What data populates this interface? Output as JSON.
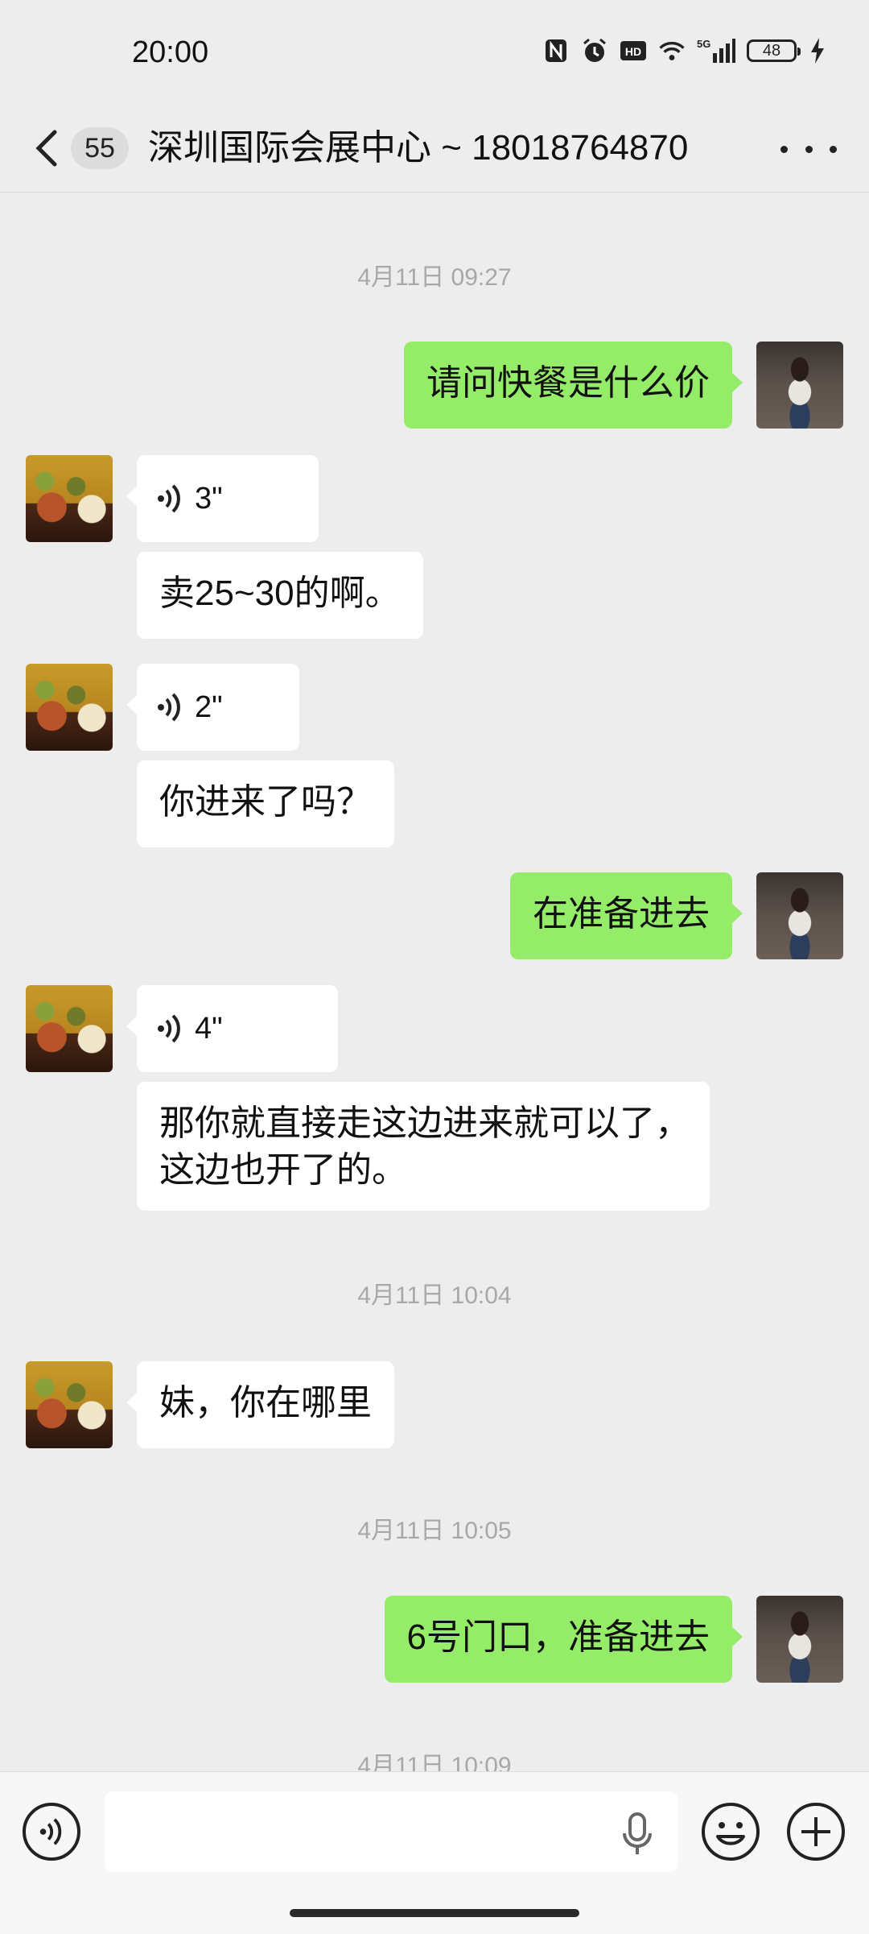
{
  "status_bar": {
    "time": "20:00",
    "battery": "48",
    "icons": [
      "nfc-icon",
      "alarm-icon",
      "hd-icon",
      "wifi-icon",
      "5g-signal-icon",
      "battery-icon",
      "charging-icon"
    ]
  },
  "nav": {
    "unread_count": "55",
    "title": "深圳国际会展中心 ~ 18018764870"
  },
  "messages": {
    "ts1": "4月11日 09:27",
    "m1": "请问快餐是什么价",
    "v1": "3\"",
    "m2": "卖25~30的啊。",
    "v2": "2\"",
    "m3": "你进来了吗？",
    "m4": "在准备进去",
    "v3": "4\"",
    "m5_line1": "那你就直接走这边进来就可以了，",
    "m5_line2": "这边也开了的。",
    "ts2": "4月11日 10:04",
    "m6": "妹，你在哪里",
    "ts3": "4月11日 10:05",
    "m7": "6号门口，准备进去",
    "ts4": "4月11日 10:09"
  },
  "colors": {
    "background": "#ededed",
    "outgoing_bubble": "#95ec69",
    "incoming_bubble": "#ffffff",
    "timestamp": "#a8a8a8"
  }
}
